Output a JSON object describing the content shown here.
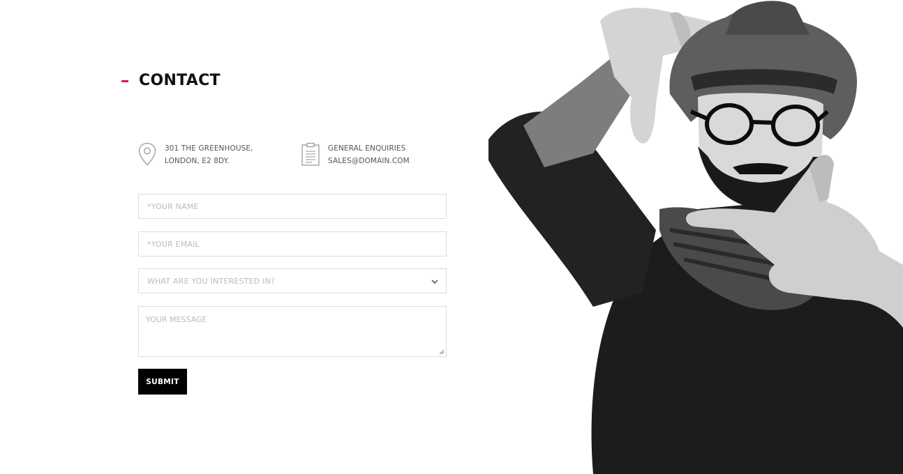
{
  "section": {
    "title": "CONTACT",
    "accent_color": "#e0115f"
  },
  "contact_info": {
    "address": {
      "icon": "map-pin-icon",
      "line1": "301 THE GREENHOUSE,",
      "line2": "LONDON, E2 8DY."
    },
    "enquiries": {
      "icon": "clipboard-icon",
      "line1": "GENERAL ENQUIRIES",
      "line2": "SALES@DOMAIN.COM"
    }
  },
  "form": {
    "name_placeholder": "*YOUR NAME",
    "email_placeholder": "*YOUR EMAIL",
    "interest_placeholder": "WHAT ARE YOU INTERESTED IN?",
    "message_placeholder": "YOUR MESSAGE",
    "submit_label": "SUBMIT"
  },
  "hero_image": {
    "description": "black and white photo of bearded man in hat and glasses framing with hands",
    "style": "monochrome"
  }
}
